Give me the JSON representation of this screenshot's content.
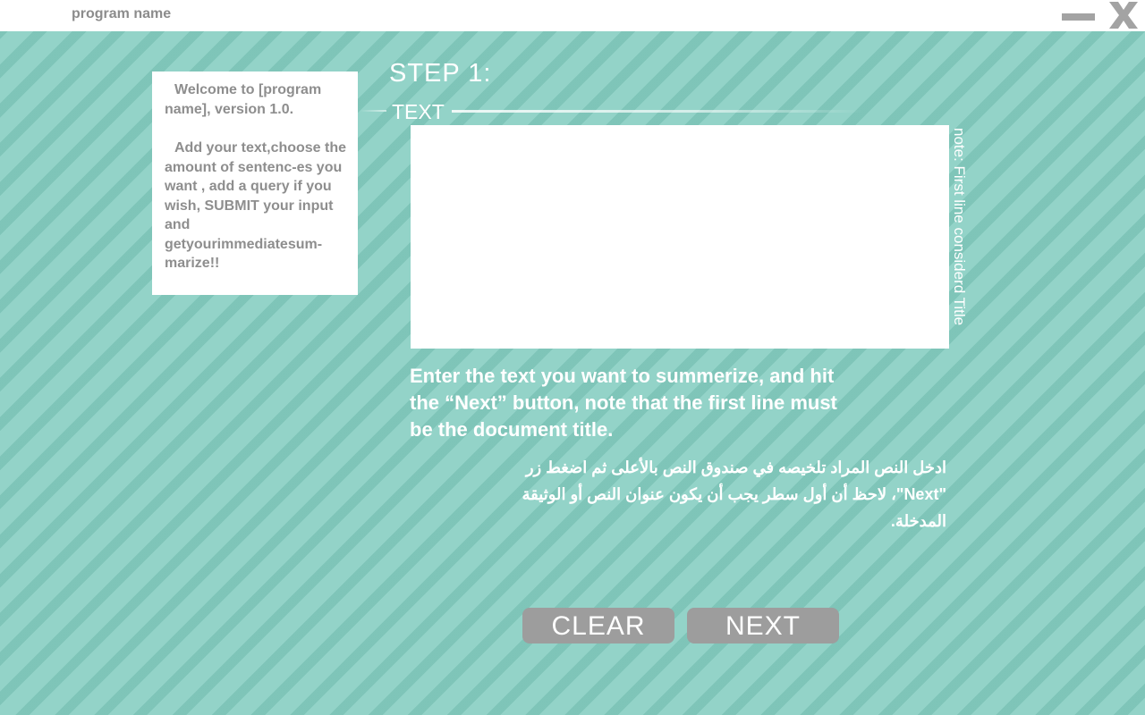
{
  "window": {
    "app_name": "program name",
    "minimize_icon": "minimize-icon",
    "close_icon": "close-icon"
  },
  "welcome": {
    "intro": "Welcome to [program name], version 1.0.",
    "body": "Add your text,choose the amount of sentenc-es you want , add a query if you wish, SUBMIT your input and getyourimmediatesum-marize!!"
  },
  "step": {
    "title": "STEP 1:",
    "section_label": "TEXT"
  },
  "text_input": {
    "value": "",
    "note": "note: First line considerd Title"
  },
  "instructions": {
    "english": "Enter the text you want to summerize, and hit the “Next” button, note that the first line must be the document title.",
    "arabic": "ادخل النص المراد تلخيصه في صندوق النص بالأعلى ثم اضغط زر \"Next\"، لاحظ أن أول سطر يجب أن يكون عنوان النص أو الوثيقة المدخلة."
  },
  "buttons": {
    "clear_label": "CLEAR",
    "next_label": "NEXT"
  },
  "colors": {
    "background": "#93d3c8",
    "stripe": "#6eb9ac",
    "button": "#9d9d9d",
    "panel_text": "#8e8e8e"
  }
}
